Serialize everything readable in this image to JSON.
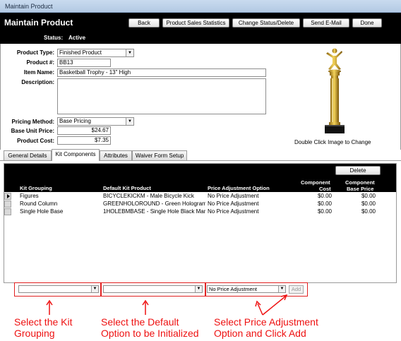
{
  "window": {
    "title": "Maintain Product"
  },
  "header": {
    "title": "Maintain Product",
    "status_label": "Status:",
    "status_value": "Active",
    "buttons": {
      "back": "Back",
      "sales_stats": "Product Sales Statistics",
      "change_status": "Change Status/Delete",
      "send_email": "Send E-Mail",
      "done": "Done"
    }
  },
  "form": {
    "product_type": {
      "label": "Product Type:",
      "value": "Finished Product"
    },
    "product_number": {
      "label": "Product #:",
      "value": "BB13"
    },
    "item_name": {
      "label": "Item Name:",
      "value": "Basketball Trophy - 13\" High"
    },
    "description": {
      "label": "Description:",
      "value": ""
    },
    "pricing_method": {
      "label": "Pricing Method:",
      "value": "Base Pricing"
    },
    "base_unit_price": {
      "label": "Base Unit Price:",
      "value": "$24.67"
    },
    "product_cost": {
      "label": "Product Cost:",
      "value": "$7.35"
    }
  },
  "image": {
    "caption": "Double Click Image to Change"
  },
  "tabs": [
    {
      "label": "General Details",
      "active": false
    },
    {
      "label": "Kit Components",
      "active": true
    },
    {
      "label": "Attributes",
      "active": false
    },
    {
      "label": "Waiver Form Setup",
      "active": false
    }
  ],
  "kit": {
    "delete_label": "Delete",
    "columns": {
      "grouping": "Kit Grouping",
      "default_product": "Default Kit Product",
      "price_adjustment": "Price Adjustment Option",
      "component_cost_1": "Component",
      "component_cost_2": "Cost",
      "component_base_1": "Component",
      "component_base_2": "Base Price"
    },
    "rows": [
      {
        "grouping": "Figures",
        "default_product": "BICYCLEKICKM - Male Bicycle Kick",
        "price_adjustment": "No Price Adjustment",
        "cost": "$0.00",
        "base_price": "$0.00"
      },
      {
        "grouping": "Round Column",
        "default_product": "GREENHOLOROUND - Green Hologram",
        "price_adjustment": "No Price Adjustment",
        "cost": "$0.00",
        "base_price": "$0.00"
      },
      {
        "grouping": "Single Hole Base",
        "default_product": "1HOLEBMBASE - Single Hole Black Mar",
        "price_adjustment": "No Price Adjustment",
        "cost": "$0.00",
        "base_price": "$0.00"
      }
    ],
    "add_row": {
      "grouping_value": "",
      "default_value": "",
      "price_adjustment_value": "No Price Adjustment",
      "add_label": "Add"
    }
  },
  "annotations": {
    "kit_grouping": [
      "Select the Kit",
      "Grouping"
    ],
    "default_option": [
      "Select the Default",
      "Option to be Initialized"
    ],
    "price_adjustment": [
      "Select Price Adjustment",
      "Option and Click Add"
    ]
  },
  "colors": {
    "annotation": "#ee1111",
    "header_bg": "#000000",
    "trophy_gold": "#d8a820"
  }
}
